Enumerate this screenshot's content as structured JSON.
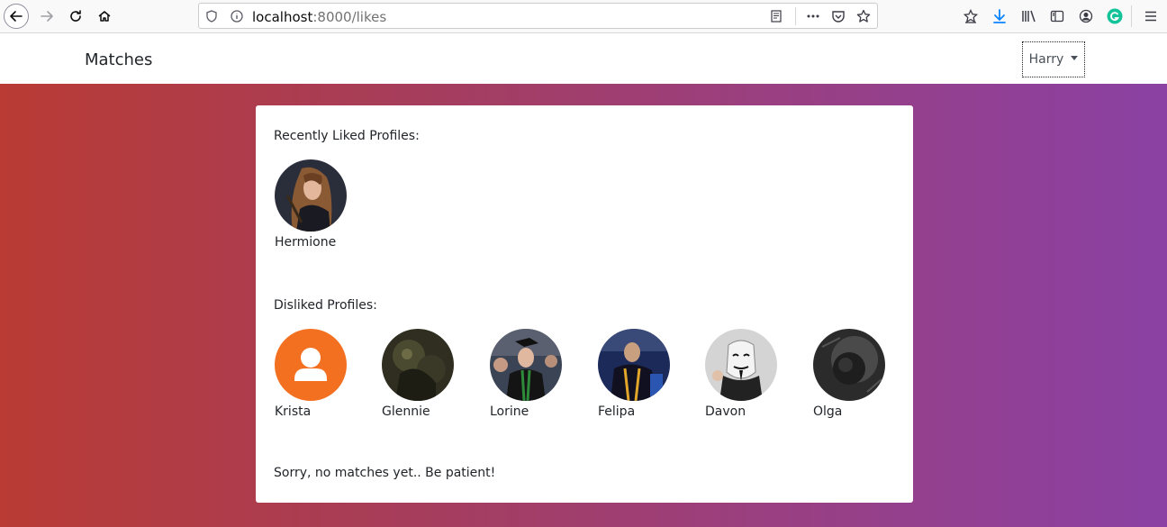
{
  "browser": {
    "url_host": "localhost",
    "url_path": ":8000/likes"
  },
  "navbar": {
    "brand": "Matches",
    "user": "Harry"
  },
  "liked": {
    "title": "Recently Liked Profiles:",
    "profiles": [
      {
        "name": "Hermione"
      }
    ]
  },
  "disliked": {
    "title": "Disliked Profiles:",
    "profiles": [
      {
        "name": "Krista"
      },
      {
        "name": "Glennie"
      },
      {
        "name": "Lorine"
      },
      {
        "name": "Felipa"
      },
      {
        "name": "Davon"
      },
      {
        "name": "Olga"
      }
    ]
  },
  "matches": {
    "notice": "Sorry, no matches yet.. Be patient!"
  },
  "colors": {
    "placeholder_avatar": "#f37021",
    "gradient_left": "#b93b34",
    "gradient_right": "#8a41a3"
  }
}
